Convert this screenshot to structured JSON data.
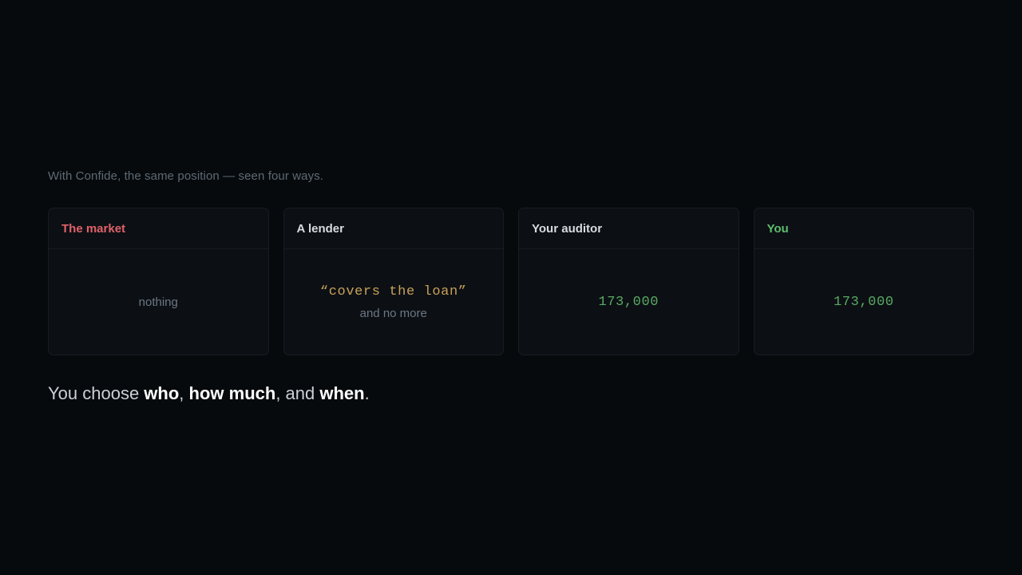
{
  "intro": "With Confide, the same position — seen four ways.",
  "cards": [
    {
      "title": "The market",
      "value": "nothing"
    },
    {
      "title": "A lender",
      "value": "“covers the loan”",
      "note": "and no more"
    },
    {
      "title": "Your auditor",
      "value": "173,000"
    },
    {
      "title": "You",
      "value": "173,000"
    }
  ],
  "tagline": {
    "prefix": "You choose ",
    "who": "who",
    "sep1": ", ",
    "how_much": "how much",
    "sep2": ", and ",
    "when": "when",
    "suffix": "."
  },
  "colors": {
    "background": "#070a0c",
    "market_title": "#e0616a",
    "you_title": "#5fbf6e",
    "lender_value": "#c9a05a",
    "amount_value": "#5aa964"
  }
}
